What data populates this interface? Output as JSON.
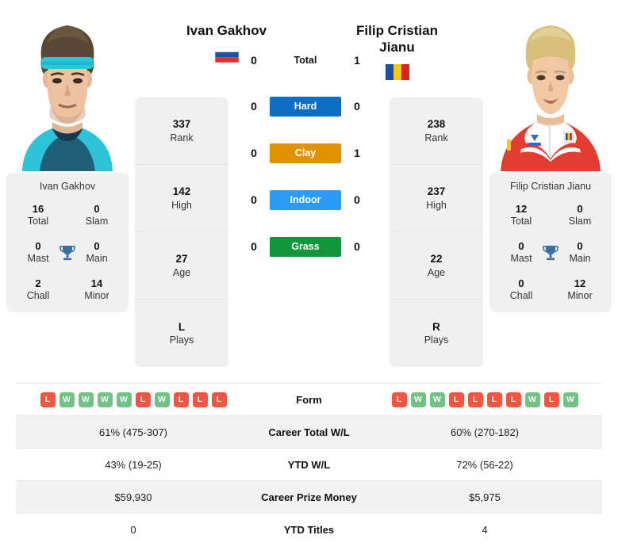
{
  "players": {
    "left": {
      "name": "Ivan Gakhov",
      "country": "russia",
      "photo_alt": "ivan-gakhov-photo",
      "rank": "337",
      "rank_label": "Rank",
      "high": "142",
      "high_label": "High",
      "age": "27",
      "age_label": "Age",
      "plays": "L",
      "plays_label": "Plays",
      "titles": {
        "total": "16",
        "total_label": "Total",
        "slam": "0",
        "slam_label": "Slam",
        "mast": "0",
        "mast_label": "Mast",
        "main": "0",
        "main_label": "Main",
        "chall": "2",
        "chall_label": "Chall",
        "minor": "14",
        "minor_label": "Minor"
      }
    },
    "right": {
      "name": "Filip Cristian Jianu",
      "name_line1": "Filip Cristian",
      "name_line2": "Jianu",
      "country": "romania",
      "photo_alt": "filip-cristian-jianu-photo",
      "rank": "238",
      "rank_label": "Rank",
      "high": "237",
      "high_label": "High",
      "age": "22",
      "age_label": "Age",
      "plays": "R",
      "plays_label": "Plays",
      "titles": {
        "total": "12",
        "total_label": "Total",
        "slam": "0",
        "slam_label": "Slam",
        "mast": "0",
        "mast_label": "Mast",
        "main": "0",
        "main_label": "Main",
        "chall": "0",
        "chall_label": "Chall",
        "minor": "12",
        "minor_label": "Minor"
      }
    }
  },
  "h2h": {
    "rows": [
      {
        "label": "Total",
        "left": "0",
        "right": "1",
        "color": null,
        "plain": true
      },
      {
        "label": "Hard",
        "left": "0",
        "right": "0",
        "color": "#0d6ec4",
        "plain": false
      },
      {
        "label": "Clay",
        "left": "0",
        "right": "1",
        "color": "#e09200",
        "plain": false
      },
      {
        "label": "Indoor",
        "left": "0",
        "right": "0",
        "color": "#2b9cf5",
        "plain": false
      },
      {
        "label": "Grass",
        "left": "0",
        "right": "0",
        "color": "#11963c",
        "plain": false
      }
    ]
  },
  "table": {
    "form": {
      "label": "Form",
      "left": [
        "L",
        "W",
        "W",
        "W",
        "W",
        "L",
        "W",
        "L",
        "L",
        "L"
      ],
      "right": [
        "L",
        "W",
        "W",
        "L",
        "L",
        "L",
        "L",
        "W",
        "L",
        "W"
      ]
    },
    "rows": [
      {
        "label": "Career Total W/L",
        "left": "61% (475-307)",
        "right": "60% (270-182)"
      },
      {
        "label": "YTD W/L",
        "left": "43% (19-25)",
        "right": "72% (56-22)"
      },
      {
        "label": "Career Prize Money",
        "left": "$59,930",
        "right": "$5,975"
      },
      {
        "label": "YTD Titles",
        "left": "0",
        "right": "4"
      }
    ]
  },
  "colors": {
    "win": "#71c285",
    "loss": "#ef5540",
    "trophy": "#3a6ea5",
    "card_bg": "#f0f0f0"
  }
}
